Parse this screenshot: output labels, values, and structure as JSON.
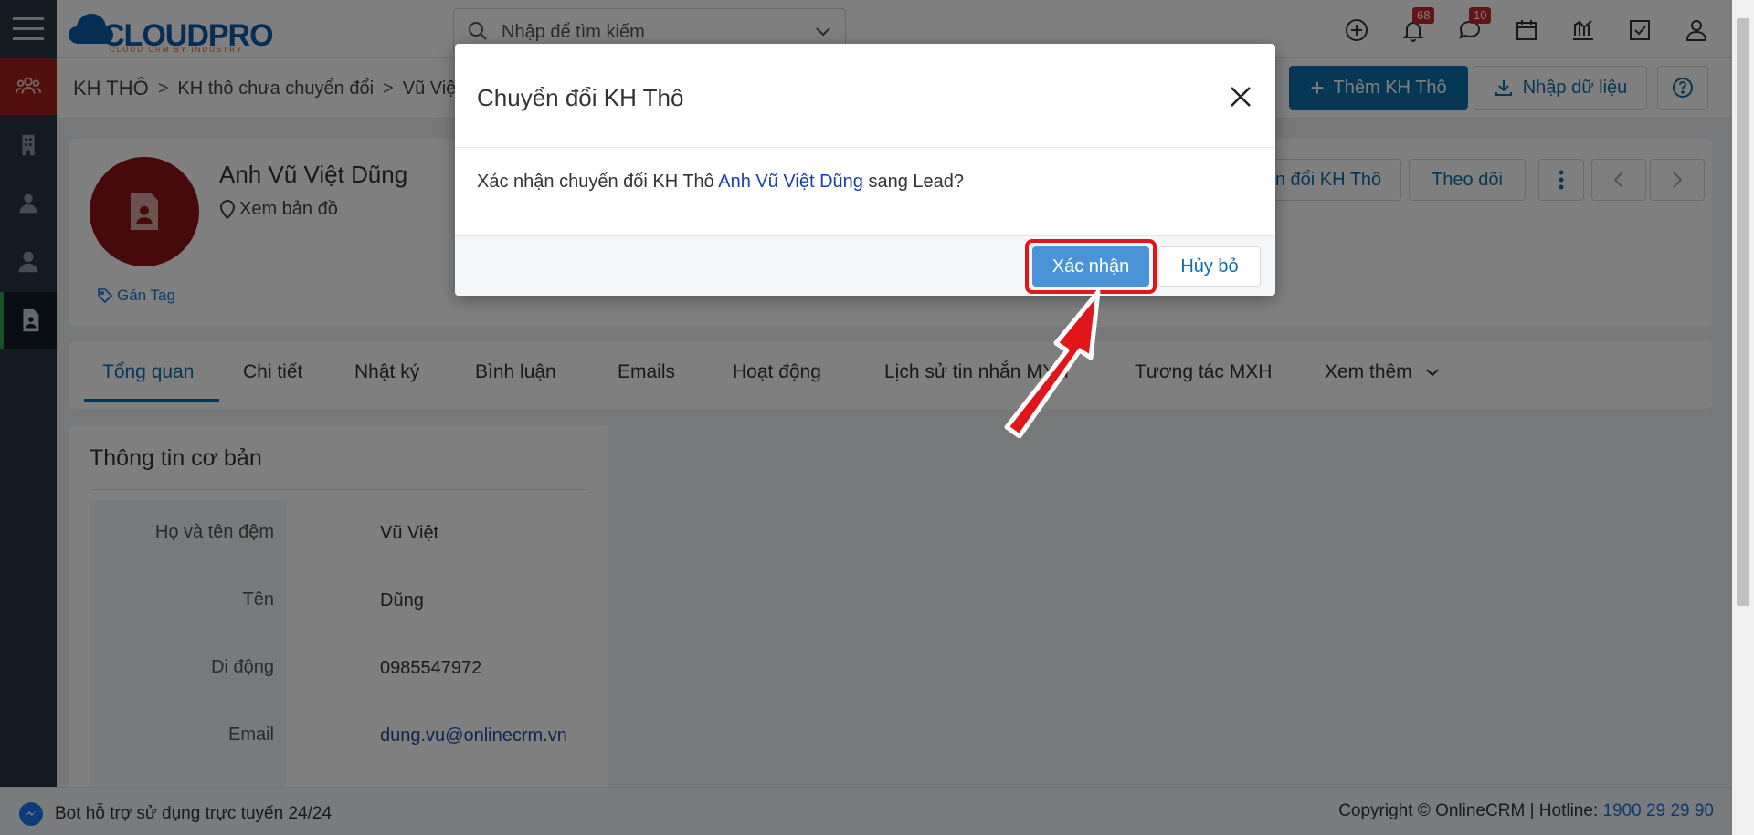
{
  "app": {
    "logo_text": "CLOUDPRO",
    "logo_tagline": "CLOUD CRM BY INDUSTRY"
  },
  "header": {
    "search_placeholder": "Nhập để tìm kiếm",
    "notifications_count": "68",
    "messages_count": "10"
  },
  "breadcrumb": {
    "items": [
      "KH THÔ",
      "KH thô chưa chuyển đổi",
      "Vũ Việt"
    ]
  },
  "actions": {
    "add_label": "Thêm KH Thô",
    "import_label": "Nhập dữ liệu"
  },
  "profile": {
    "name": "Anh Vũ Việt Dũng",
    "map_label": "Xem bản đồ",
    "tag_label": "Gán Tag",
    "convert_label": "n đổi KH Thô",
    "follow_label": "Theo dõi"
  },
  "tabs": [
    "Tổng quan",
    "Chi tiết",
    "Nhật ký",
    "Bình luận",
    "Emails",
    "Hoạt động",
    "Lịch sử tin nhắn MXH",
    "Tương tác MXH",
    "Xem thêm"
  ],
  "info": {
    "title": "Thông tin cơ bản",
    "fields": [
      {
        "label": "Họ và tên đệm",
        "value": "Vũ Việt"
      },
      {
        "label": "Tên",
        "value": "Dũng"
      },
      {
        "label": "Di động",
        "value": "0985547972"
      },
      {
        "label": "Email",
        "value": "dung.vu@onlinecrm.vn"
      }
    ]
  },
  "footer": {
    "bot_text": "Bot hỗ trợ sử dụng trực tuyến 24/24",
    "copyright": "Copyright © OnlineCRM",
    "hotline_label": "Hotline:",
    "hotline_number": "1900 29 29 90"
  },
  "modal": {
    "title": "Chuyển đổi KH Thô",
    "body_prefix": "Xác nhận chuyển đổi KH Thô",
    "body_name": "Anh Vũ Việt Dũng",
    "body_suffix": "sang Lead?",
    "confirm_label": "Xác nhận",
    "cancel_label": "Hủy bỏ"
  },
  "colors": {
    "primary": "#0d6fa8",
    "sidebar": "#263545",
    "highlight": "#e0161b",
    "confirm": "#4a93d6"
  }
}
